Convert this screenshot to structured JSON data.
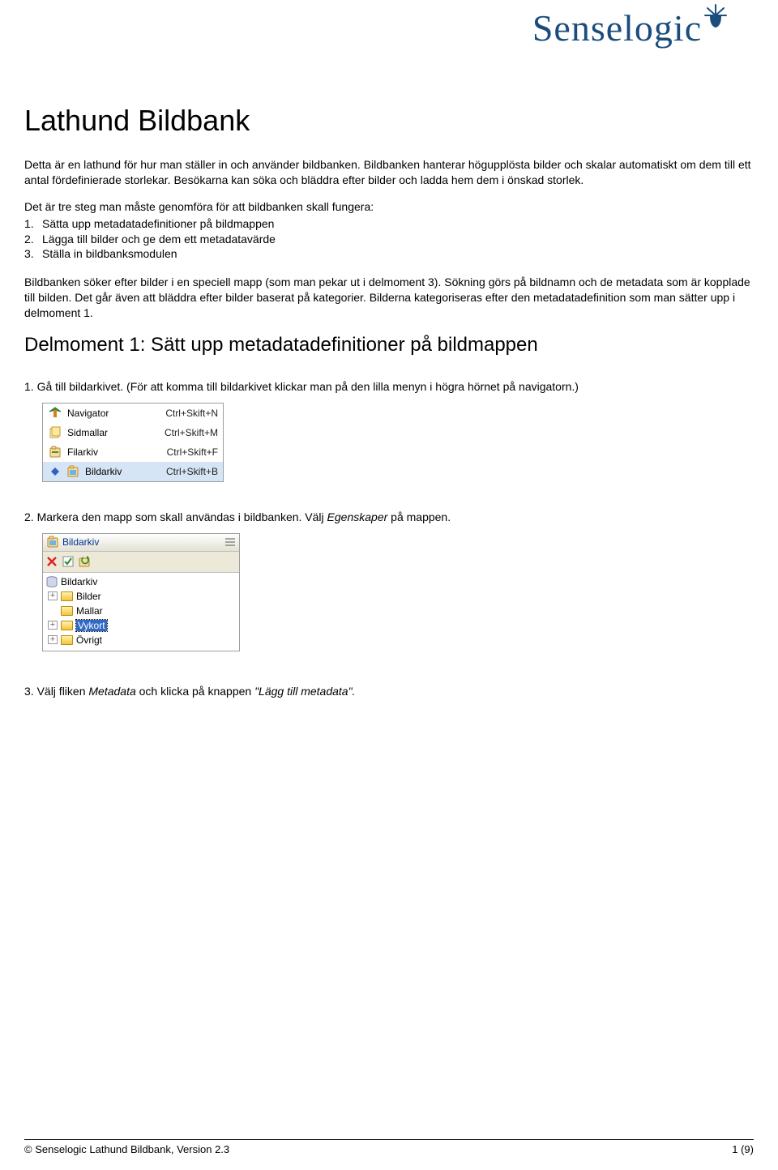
{
  "logo": {
    "text": "Senselogic"
  },
  "title": "Lathund Bildbank",
  "intro1": "Detta är en lathund för hur man ställer in och använder bildbanken. Bildbanken hanterar högupplösta bilder och skalar automatiskt om dem till ett antal fördefinierade storlekar. Besökarna kan söka och bläddra efter bilder och ladda hem dem i önskad storlek.",
  "steps_intro": "Det är tre steg man måste genomföra för att bildbanken skall fungera:",
  "steps": [
    "Sätta upp metadatadefinitioner på bildmappen",
    "Lägga till bilder och ge dem ett metadatavärde",
    "Ställa in bildbanksmodulen"
  ],
  "intro2": "Bildbanken söker efter bilder i en speciell mapp (som man pekar ut i delmoment 3). Sökning görs på bildnamn och de metadata som är kopplade till bilden. Det går även att bläddra efter bilder baserat på kategorier. Bilderna kategoriseras efter den metadatadefinition som man sätter upp i delmoment 1.",
  "h2": "Delmoment 1: Sätt upp metadatadefinitioner på bildmappen",
  "inst1": "1. Gå till bildarkivet. (För att komma till bildarkivet klickar man på den lilla menyn i högra hörnet på navigatorn.)",
  "inst2_pre": "2. Markera den mapp som skall användas i bildbanken. Välj ",
  "inst2_em": "Egenskaper",
  "inst2_post": " på mappen.",
  "inst3_pre": "3. Välj fliken ",
  "inst3_em1": "Metadata",
  "inst3_mid": " och klicka på knappen ",
  "inst3_em2": "\"Lägg till metadata\".",
  "menu": {
    "items": [
      {
        "label": "Navigator",
        "shortcut": "Ctrl+Skift+N"
      },
      {
        "label": "Sidmallar",
        "shortcut": "Ctrl+Skift+M"
      },
      {
        "label": "Filarkiv",
        "shortcut": "Ctrl+Skift+F"
      },
      {
        "label": "Bildarkiv",
        "shortcut": "Ctrl+Skift+B"
      }
    ]
  },
  "tree": {
    "title": "Bildarkiv",
    "root": "Bildarkiv",
    "nodes": [
      {
        "label": "Bilder"
      },
      {
        "label": "Mallar"
      },
      {
        "label": "Vykort",
        "selected": true
      },
      {
        "label": "Övrigt"
      }
    ]
  },
  "footer": {
    "left": "© Senselogic Lathund Bildbank, Version 2.3",
    "right": "1 (9)"
  }
}
